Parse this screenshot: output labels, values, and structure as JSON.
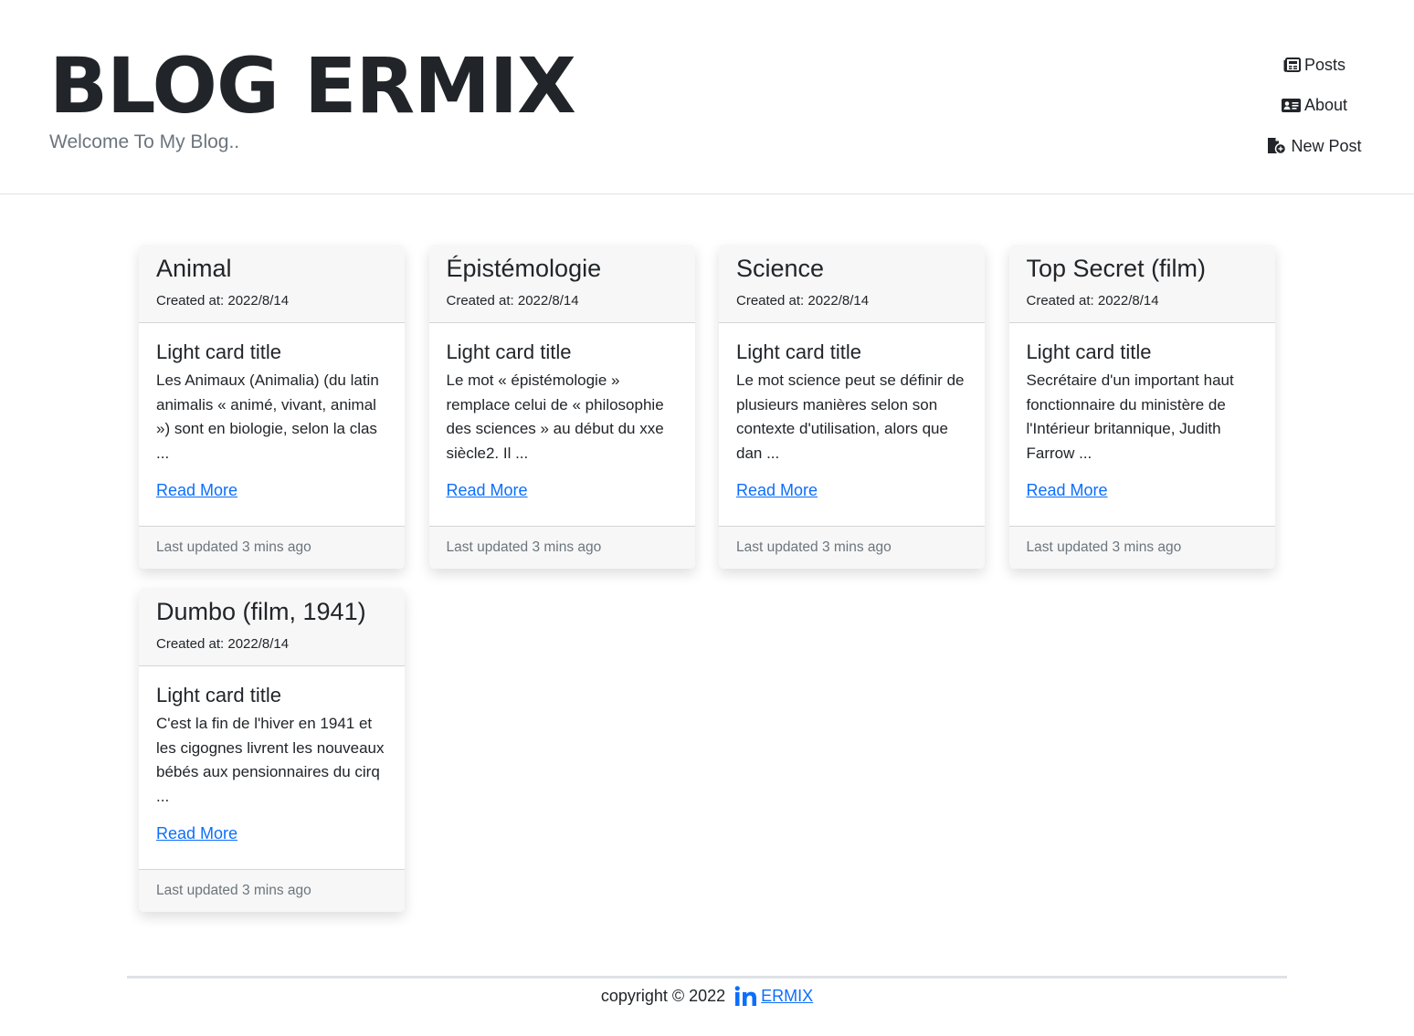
{
  "header": {
    "title": "BLOG ERMIX",
    "subtitle": "Welcome To My Blog..",
    "nav": [
      {
        "label": "Posts",
        "icon": "newspaper-icon"
      },
      {
        "label": "About",
        "icon": "id-card-icon"
      },
      {
        "label": "New Post",
        "icon": "file-add-icon"
      }
    ]
  },
  "posts": [
    {
      "title": "Animal",
      "created": "Created at: 2022/8/14",
      "subtitle": "Light card title",
      "excerpt": "Les Animaux (Animalia) (du latin animalis « animé, vivant, animal ») sont en biologie, selon la clas ...",
      "link": "Read More",
      "updated": "Last updated 3 mins ago"
    },
    {
      "title": "Épistémologie",
      "created": "Created at: 2022/8/14",
      "subtitle": "Light card title",
      "excerpt": "Le mot « épistémologie » remplace celui de « philosophie des sciences » au début du xxe siècle2. Il ...",
      "link": "Read More",
      "updated": "Last updated 3 mins ago"
    },
    {
      "title": "Science",
      "created": "Created at: 2022/8/14",
      "subtitle": "Light card title",
      "excerpt": "Le mot science peut se définir de plusieurs manières selon son contexte d'utilisation, alors que dan ...",
      "link": "Read More",
      "updated": "Last updated 3 mins ago"
    },
    {
      "title": "Top Secret (film)",
      "created": "Created at: 2022/8/14",
      "subtitle": "Light card title",
      "excerpt": "Secrétaire d'un important haut fonctionnaire du ministère de l'Intérieur britannique, Judith Farrow ...",
      "link": "Read More",
      "updated": "Last updated 3 mins ago"
    },
    {
      "title": "Dumbo (film, 1941)",
      "created": "Created at: 2022/8/14",
      "subtitle": "Light card title",
      "excerpt": "C'est la fin de l'hiver en 1941 et les cigognes livrent les nouveaux bébés aux pensionnaires du cirq ...",
      "link": "Read More",
      "updated": "Last updated 3 mins ago"
    }
  ],
  "footer": {
    "copyright": "copyright © 2022",
    "link_label": "ERMIX",
    "link_icon": "linkedin-icon"
  },
  "colors": {
    "accent": "#0d6efd",
    "text": "#212529",
    "muted": "#6c757d",
    "card_header_bg": "#f7f7f7"
  }
}
